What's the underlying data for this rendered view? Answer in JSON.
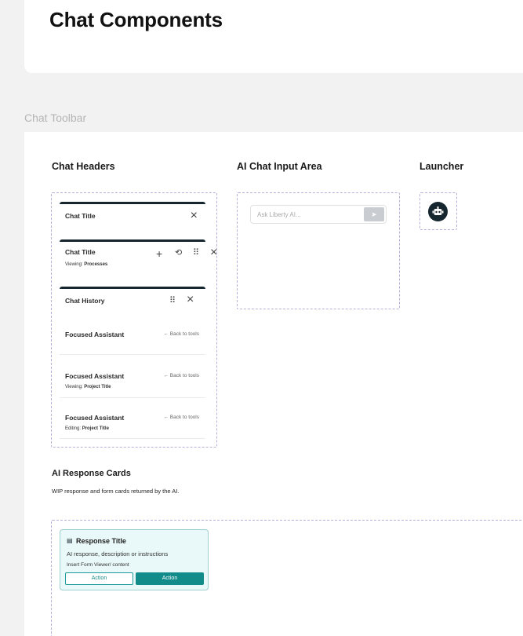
{
  "page": {
    "title": "Chat Components",
    "section_label": "Chat Toolbar"
  },
  "chat_headers": {
    "title": "Chat Headers",
    "header1": {
      "title": "Chat Title",
      "close_icon": "×"
    },
    "header2": {
      "title": "Chat Title",
      "viewing_prefix": "Viewing:",
      "viewing_value": "Processes",
      "icons": {
        "add": "+",
        "history": "⟲",
        "drag": "⠿",
        "close": "×"
      }
    },
    "header3": {
      "title": "Chat History",
      "icons": {
        "drag": "⠿",
        "close": "×"
      }
    },
    "assistant_rows": [
      {
        "title": "Focused Assistant",
        "back": "← Back to tools",
        "sub_prefix": "",
        "sub_value": ""
      },
      {
        "title": "Focused Assistant",
        "back": "← Back to tools",
        "sub_prefix": "Viewing:",
        "sub_value": "Project Title"
      },
      {
        "title": "Focused Assistant",
        "back": "← Back to tools",
        "sub_prefix": "Editing:",
        "sub_value": "Project Title"
      }
    ]
  },
  "ai_input": {
    "title": "AI Chat Input Area",
    "placeholder": "Ask Liberty AI...",
    "send_icon": "➤"
  },
  "launcher": {
    "title": "Launcher",
    "icon": "robot-icon"
  },
  "response_cards": {
    "title": "AI Response Cards",
    "description": "WIP response and form cards returned by the AI.",
    "card": {
      "title": "Response Title",
      "description": "AI response, description or instructions",
      "insert_text": "Insert Form Viewer/ content",
      "action1": "Action",
      "action2": "Action"
    }
  },
  "colors": {
    "accent_dark": "#16262e",
    "teal": "#128b8b",
    "dashed_border": "#b8b0d8"
  }
}
